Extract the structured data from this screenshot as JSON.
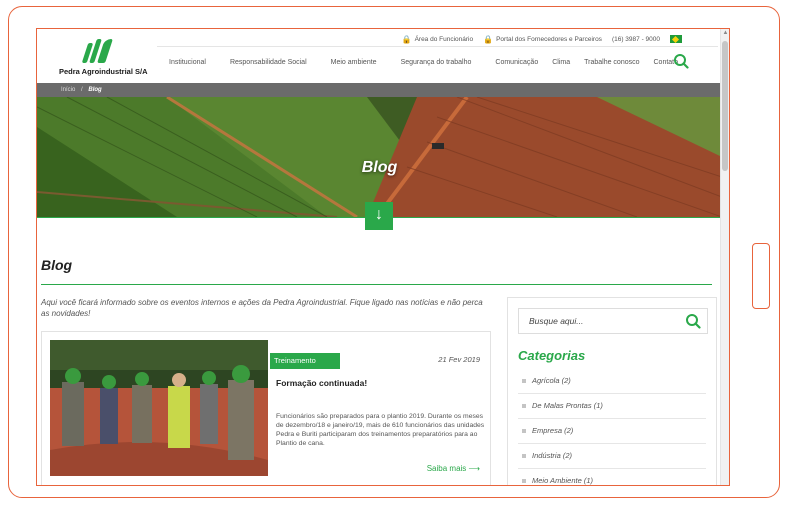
{
  "topbar": {
    "employee_area": "Área do Funcionário",
    "suppliers_portal": "Portal dos Fornecedores e Parceiros",
    "phone": "(16) 3987 - 9000"
  },
  "brand": {
    "name": "Pedra Agroindustrial S/A",
    "color": "#2aa84a"
  },
  "nav": {
    "items": [
      "Institucional",
      "Responsabilidade Social",
      "Meio ambiente",
      "Segurança do trabalho",
      "Comunicação",
      "Clima",
      "Trabalhe conosco",
      "Contato"
    ]
  },
  "breadcrumb": {
    "home": "Início",
    "separator": "/",
    "current": "Blog"
  },
  "hero": {
    "title": "Blog"
  },
  "content": {
    "heading": "Blog",
    "intro": "Aqui você ficará informado sobre os eventos internos e ações da Pedra Agroindustrial. Fique ligado nas notícias e não perca as novidades!"
  },
  "post": {
    "tag": "Treinamento",
    "date": "21 Fev 2019",
    "title": "Formação continuada!",
    "excerpt": "Funcionários são preparados para o plantio 2019. Durante os meses de dezembro/18 e janeiro/19, mais de 610 funcionários das unidades Pedra e Buriti participaram dos treinamentos preparatórios para ao Plantio de cana.",
    "read_more": "Saiba mais"
  },
  "sidebar": {
    "search_placeholder": "Busque aqui...",
    "categories_title": "Categorias",
    "categories": [
      "Agrícola (2)",
      "De Malas Prontas (1)",
      "Empresa (2)",
      "Indústria (2)",
      "Meio Ambiente (1)"
    ]
  }
}
